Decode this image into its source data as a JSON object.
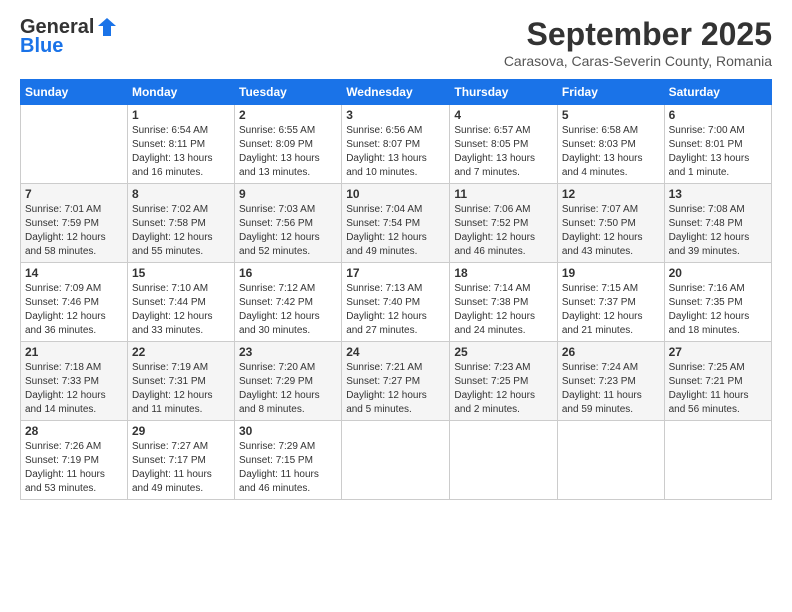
{
  "header": {
    "logo_line1": "General",
    "logo_line2": "Blue",
    "month": "September 2025",
    "location": "Carasova, Caras-Severin County, Romania"
  },
  "weekdays": [
    "Sunday",
    "Monday",
    "Tuesday",
    "Wednesday",
    "Thursday",
    "Friday",
    "Saturday"
  ],
  "weeks": [
    [
      {
        "day": "",
        "info": ""
      },
      {
        "day": "1",
        "info": "Sunrise: 6:54 AM\nSunset: 8:11 PM\nDaylight: 13 hours\nand 16 minutes."
      },
      {
        "day": "2",
        "info": "Sunrise: 6:55 AM\nSunset: 8:09 PM\nDaylight: 13 hours\nand 13 minutes."
      },
      {
        "day": "3",
        "info": "Sunrise: 6:56 AM\nSunset: 8:07 PM\nDaylight: 13 hours\nand 10 minutes."
      },
      {
        "day": "4",
        "info": "Sunrise: 6:57 AM\nSunset: 8:05 PM\nDaylight: 13 hours\nand 7 minutes."
      },
      {
        "day": "5",
        "info": "Sunrise: 6:58 AM\nSunset: 8:03 PM\nDaylight: 13 hours\nand 4 minutes."
      },
      {
        "day": "6",
        "info": "Sunrise: 7:00 AM\nSunset: 8:01 PM\nDaylight: 13 hours\nand 1 minute."
      }
    ],
    [
      {
        "day": "7",
        "info": "Sunrise: 7:01 AM\nSunset: 7:59 PM\nDaylight: 12 hours\nand 58 minutes."
      },
      {
        "day": "8",
        "info": "Sunrise: 7:02 AM\nSunset: 7:58 PM\nDaylight: 12 hours\nand 55 minutes."
      },
      {
        "day": "9",
        "info": "Sunrise: 7:03 AM\nSunset: 7:56 PM\nDaylight: 12 hours\nand 52 minutes."
      },
      {
        "day": "10",
        "info": "Sunrise: 7:04 AM\nSunset: 7:54 PM\nDaylight: 12 hours\nand 49 minutes."
      },
      {
        "day": "11",
        "info": "Sunrise: 7:06 AM\nSunset: 7:52 PM\nDaylight: 12 hours\nand 46 minutes."
      },
      {
        "day": "12",
        "info": "Sunrise: 7:07 AM\nSunset: 7:50 PM\nDaylight: 12 hours\nand 43 minutes."
      },
      {
        "day": "13",
        "info": "Sunrise: 7:08 AM\nSunset: 7:48 PM\nDaylight: 12 hours\nand 39 minutes."
      }
    ],
    [
      {
        "day": "14",
        "info": "Sunrise: 7:09 AM\nSunset: 7:46 PM\nDaylight: 12 hours\nand 36 minutes."
      },
      {
        "day": "15",
        "info": "Sunrise: 7:10 AM\nSunset: 7:44 PM\nDaylight: 12 hours\nand 33 minutes."
      },
      {
        "day": "16",
        "info": "Sunrise: 7:12 AM\nSunset: 7:42 PM\nDaylight: 12 hours\nand 30 minutes."
      },
      {
        "day": "17",
        "info": "Sunrise: 7:13 AM\nSunset: 7:40 PM\nDaylight: 12 hours\nand 27 minutes."
      },
      {
        "day": "18",
        "info": "Sunrise: 7:14 AM\nSunset: 7:38 PM\nDaylight: 12 hours\nand 24 minutes."
      },
      {
        "day": "19",
        "info": "Sunrise: 7:15 AM\nSunset: 7:37 PM\nDaylight: 12 hours\nand 21 minutes."
      },
      {
        "day": "20",
        "info": "Sunrise: 7:16 AM\nSunset: 7:35 PM\nDaylight: 12 hours\nand 18 minutes."
      }
    ],
    [
      {
        "day": "21",
        "info": "Sunrise: 7:18 AM\nSunset: 7:33 PM\nDaylight: 12 hours\nand 14 minutes."
      },
      {
        "day": "22",
        "info": "Sunrise: 7:19 AM\nSunset: 7:31 PM\nDaylight: 12 hours\nand 11 minutes."
      },
      {
        "day": "23",
        "info": "Sunrise: 7:20 AM\nSunset: 7:29 PM\nDaylight: 12 hours\nand 8 minutes."
      },
      {
        "day": "24",
        "info": "Sunrise: 7:21 AM\nSunset: 7:27 PM\nDaylight: 12 hours\nand 5 minutes."
      },
      {
        "day": "25",
        "info": "Sunrise: 7:23 AM\nSunset: 7:25 PM\nDaylight: 12 hours\nand 2 minutes."
      },
      {
        "day": "26",
        "info": "Sunrise: 7:24 AM\nSunset: 7:23 PM\nDaylight: 11 hours\nand 59 minutes."
      },
      {
        "day": "27",
        "info": "Sunrise: 7:25 AM\nSunset: 7:21 PM\nDaylight: 11 hours\nand 56 minutes."
      }
    ],
    [
      {
        "day": "28",
        "info": "Sunrise: 7:26 AM\nSunset: 7:19 PM\nDaylight: 11 hours\nand 53 minutes."
      },
      {
        "day": "29",
        "info": "Sunrise: 7:27 AM\nSunset: 7:17 PM\nDaylight: 11 hours\nand 49 minutes."
      },
      {
        "day": "30",
        "info": "Sunrise: 7:29 AM\nSunset: 7:15 PM\nDaylight: 11 hours\nand 46 minutes."
      },
      {
        "day": "",
        "info": ""
      },
      {
        "day": "",
        "info": ""
      },
      {
        "day": "",
        "info": ""
      },
      {
        "day": "",
        "info": ""
      }
    ]
  ]
}
